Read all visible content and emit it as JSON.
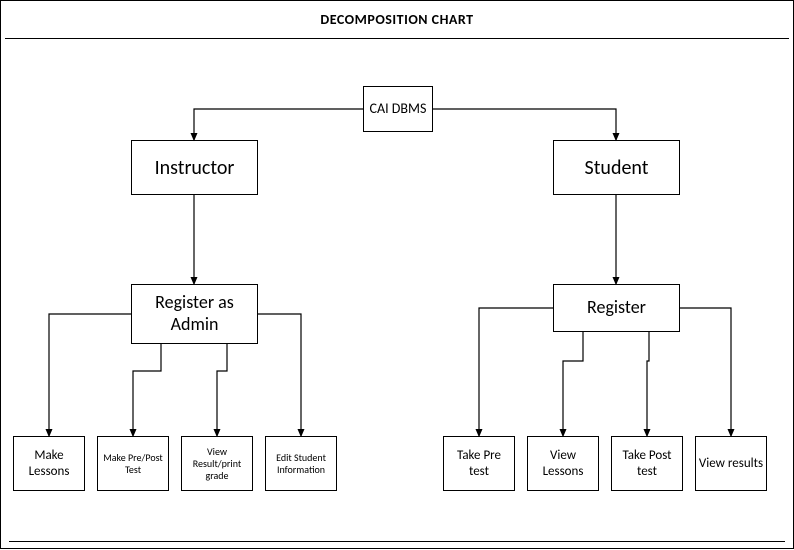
{
  "title": "DECOMPOSITION CHART",
  "root": "CAI DBMS",
  "left": {
    "l1": "Instructor",
    "l2": "Register as Admin",
    "leaves": [
      "Make Lessons",
      "Make Pre/Post Test",
      "View Result/print grade",
      "Edit Student Information"
    ]
  },
  "right": {
    "l1": "Student",
    "l2": "Register",
    "leaves": [
      "Take Pre test",
      "View Lessons",
      "Take Post test",
      "View results"
    ]
  }
}
